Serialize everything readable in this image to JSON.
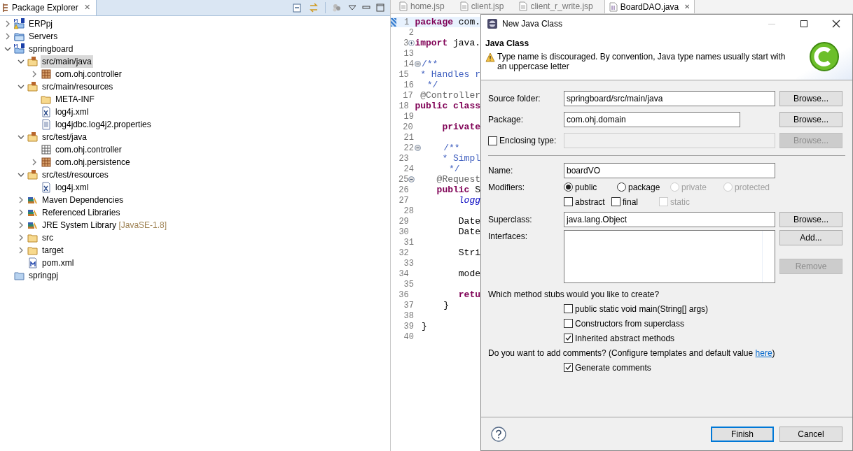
{
  "explorer": {
    "tab": {
      "label": "Package Explorer",
      "close": "✕"
    },
    "tree": [
      {
        "label": "ERPpj",
        "kind": "maven-project-warning",
        "expanded": false
      },
      {
        "label": "Servers",
        "kind": "project-folder",
        "expanded": false
      },
      {
        "label": "springboard",
        "kind": "maven-project",
        "expanded": true,
        "children": [
          {
            "label": "src/main/java",
            "kind": "source-folder",
            "expanded": true,
            "selected": true,
            "children": [
              {
                "label": "com.ohj.controller",
                "kind": "package",
                "expanded": false
              }
            ]
          },
          {
            "label": "src/main/resources",
            "kind": "source-folder",
            "expanded": true,
            "children": [
              {
                "label": "META-INF",
                "kind": "folder"
              },
              {
                "label": "log4j.xml",
                "kind": "xml-file"
              },
              {
                "label": "log4jdbc.log4j2.properties",
                "kind": "text-file"
              }
            ]
          },
          {
            "label": "src/test/java",
            "kind": "source-folder",
            "expanded": true,
            "children": [
              {
                "label": "com.ohj.controller",
                "kind": "empty-package"
              },
              {
                "label": "com.ohj.persistence",
                "kind": "package",
                "expanded": false
              }
            ]
          },
          {
            "label": "src/test/resources",
            "kind": "source-folder",
            "expanded": true,
            "children": [
              {
                "label": "log4j.xml",
                "kind": "xml-file"
              }
            ]
          },
          {
            "label": "Maven Dependencies",
            "kind": "library",
            "expanded": false
          },
          {
            "label": "Referenced Libraries",
            "kind": "library",
            "expanded": false
          },
          {
            "label": "JRE System Library",
            "suffix": "[JavaSE-1.8]",
            "kind": "library",
            "expanded": false
          },
          {
            "label": "src",
            "kind": "folder",
            "expanded": false
          },
          {
            "label": "target",
            "kind": "folder",
            "expanded": false
          },
          {
            "label": "pom.xml",
            "kind": "pom-file"
          }
        ]
      },
      {
        "label": "springpj",
        "kind": "project"
      }
    ]
  },
  "editor": {
    "tabs": [
      {
        "label": "home.jsp",
        "selected": false
      },
      {
        "label": "client.jsp",
        "selected": false
      },
      {
        "label": "client_r_write.jsp",
        "selected": false
      },
      {
        "label": "BoardDAO.java",
        "selected": true,
        "close": "✕"
      }
    ],
    "lines": [
      {
        "number": "1",
        "text": "**package** com.",
        "kind": "code",
        "current": true
      },
      {
        "number": "2"
      },
      {
        "number": "3",
        "text": "**import** java.",
        "kind": "code",
        "collapsed": true
      },
      {
        "number": "13"
      },
      {
        "number": "14",
        "text": "/**",
        "kind": "comment",
        "collapsed": false
      },
      {
        "number": "15",
        "text": " * Handles r",
        "kind": "comment"
      },
      {
        "number": "16",
        "text": " */",
        "kind": "comment"
      },
      {
        "number": "17",
        "text": "@Controller",
        "kind": "annotation"
      },
      {
        "number": "18",
        "text": "**public class**",
        "kind": "code"
      },
      {
        "number": "19"
      },
      {
        "number": "20",
        "text": "    **private**",
        "kind": "code"
      },
      {
        "number": "21"
      },
      {
        "number": "22",
        "text": "    /**",
        "kind": "comment",
        "collapsed": false
      },
      {
        "number": "23",
        "text": "     * Simpl",
        "kind": "comment"
      },
      {
        "number": "24",
        "text": "     */",
        "kind": "comment"
      },
      {
        "number": "25",
        "text": "    @Request",
        "kind": "annotation",
        "collapsed": false
      },
      {
        "number": "26",
        "text": "    **public** S",
        "kind": "code"
      },
      {
        "number": "27",
        "text": "        logg",
        "kind": "static-field"
      },
      {
        "number": "28"
      },
      {
        "number": "29",
        "text": "        Date",
        "kind": "code"
      },
      {
        "number": "30",
        "text": "        Date",
        "kind": "code"
      },
      {
        "number": "31"
      },
      {
        "number": "32",
        "text": "        Stri",
        "kind": "code"
      },
      {
        "number": "33"
      },
      {
        "number": "34",
        "text": "        mode",
        "kind": "code"
      },
      {
        "number": "35"
      },
      {
        "number": "36",
        "text": "        **retu**",
        "kind": "code"
      },
      {
        "number": "37",
        "text": "    }",
        "kind": "code"
      },
      {
        "number": "38"
      },
      {
        "number": "39",
        "text": "}",
        "kind": "code"
      },
      {
        "number": "40"
      }
    ]
  },
  "dialog": {
    "title": "New Java Class",
    "heading": "Java Class",
    "warning": "Type name is discouraged. By convention, Java type names usually start with an uppercase letter",
    "source_folder": {
      "label": "Source folder:",
      "value": "springboard/src/main/java",
      "button": "Browse..."
    },
    "package": {
      "label": "Package:",
      "value": "com.ohj.domain",
      "button": "Browse..."
    },
    "enclosing": {
      "label": "Enclosing type:",
      "checked": false,
      "button": "Browse...",
      "disabled": true
    },
    "name": {
      "label": "Name:",
      "value": "boardVO"
    },
    "modifiers": {
      "label": "Modifiers:",
      "access": [
        {
          "label": "public",
          "selected": true,
          "disabled": false
        },
        {
          "label": "package",
          "selected": false,
          "disabled": false
        },
        {
          "label": "private",
          "selected": false,
          "disabled": true
        },
        {
          "label": "protected",
          "selected": false,
          "disabled": true
        }
      ],
      "flags": [
        {
          "label": "abstract",
          "checked": false,
          "disabled": false
        },
        {
          "label": "final",
          "checked": false,
          "disabled": false
        },
        {
          "label": "static",
          "checked": false,
          "disabled": true
        }
      ]
    },
    "superclass": {
      "label": "Superclass:",
      "value": "java.lang.Object",
      "button": "Browse..."
    },
    "interfaces": {
      "label": "Interfaces:",
      "add": "Add...",
      "remove": "Remove",
      "remove_disabled": true
    },
    "stubs": {
      "question": "Which method stubs would you like to create?",
      "options": [
        {
          "label": "public static void main(String[] args)",
          "checked": false
        },
        {
          "label": "Constructors from superclass",
          "checked": false
        },
        {
          "label": "Inherited abstract methods",
          "checked": true
        }
      ]
    },
    "comments": {
      "before": "Do you want to add comments? (Configure templates and default value ",
      "link": "here",
      "after": ")",
      "option": {
        "label": "Generate comments",
        "checked": true
      }
    },
    "buttons": [
      {
        "label": "Finish",
        "default": true
      },
      {
        "label": "Cancel",
        "default": false
      }
    ]
  }
}
